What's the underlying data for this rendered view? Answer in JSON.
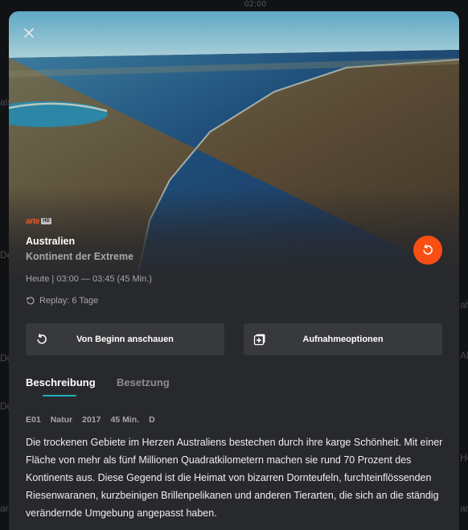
{
  "background": {
    "time_label": "02:00",
    "fragments": [
      "als",
      "De",
      "Do",
      "Do",
      "ar",
      "ah",
      "Al",
      "He",
      "ar"
    ]
  },
  "modal": {
    "close_icon": "close-icon",
    "channel": {
      "name": "arte",
      "badge": "HD"
    },
    "title": "Australien",
    "subtitle": "Kontinent der Extreme",
    "time": "Heute | 03:00 — 03:45 (45 Min.)",
    "replay": "Replay: 6 Tage",
    "fab_icon": "restart-icon",
    "accent_color": "#fa4f14",
    "tab_accent_color": "#1cb2c0",
    "actions": {
      "start_label": "Von Beginn anschauen",
      "record_label": "Aufnahmeoptionen"
    },
    "tabs": {
      "description": "Beschreibung",
      "cast": "Besetzung",
      "active": "description"
    },
    "meta": {
      "episode": "E01",
      "genre": "Natur",
      "year": "2017",
      "duration": "45 Min.",
      "country": "D"
    },
    "description": "Die trockenen Gebiete im Herzen Australiens bestechen durch ihre karge Schönheit. Mit einer Fläche von mehr als fünf Millionen Quadratkilometern machen sie rund 70 Prozent des Kontinents aus. Diese Gegend ist die Heimat von bizarren Dornteufeln, furchteinflössenden Riesenwaranen, kurzbeinigen Brillenpelikanen und anderen Tierarten, die sich an die ständig verändernde Umgebung angepasst haben."
  }
}
